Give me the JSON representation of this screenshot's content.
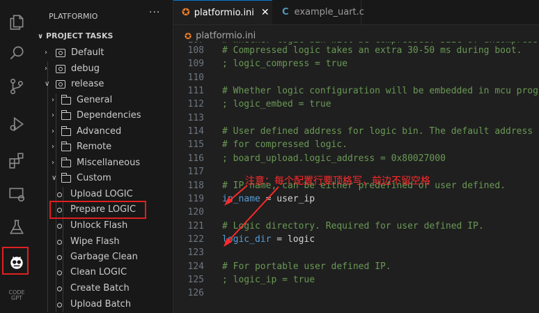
{
  "sidebar": {
    "title": "PLATFORMIO",
    "more": "···",
    "section": "PROJECT TASKS",
    "envs": [
      "Default",
      "debug",
      "release"
    ],
    "folders": [
      "General",
      "Dependencies",
      "Advanced",
      "Remote",
      "Miscellaneous",
      "Custom"
    ],
    "tasks": [
      "Upload LOGIC",
      "Prepare LOGIC",
      "Unlock Flash",
      "Wipe Flash",
      "Garbage Clean",
      "Clean LOGIC",
      "Create Batch",
      "Upload Batch"
    ]
  },
  "tabs": [
    {
      "label": "platformio.ini",
      "close": "✕"
    },
    {
      "label": "example_uart.c"
    }
  ],
  "breadcrumb": "platformio.ini",
  "code": {
    "partial_top": "# Whether logic bin will be compressed. Size of uncompress",
    "lines": [
      {
        "n": "107",
        "text": ""
      },
      {
        "n": "108",
        "text": "# Compressed logic takes an extra 30-50 ms during boot."
      },
      {
        "n": "109",
        "text": "; logic_compress = true"
      },
      {
        "n": "110",
        "text": ""
      },
      {
        "n": "111",
        "text": "# Whether logic configuration will be embedded in mcu prog"
      },
      {
        "n": "112",
        "text": "; logic_embed = true"
      },
      {
        "n": "113",
        "text": ""
      },
      {
        "n": "114",
        "text": "# User defined address for logic bin. The default address"
      },
      {
        "n": "115",
        "text": "# for compressed logic."
      },
      {
        "n": "116",
        "text": "; board_upload.logic_address = 0x80027000"
      },
      {
        "n": "117",
        "text": ""
      },
      {
        "n": "118",
        "text": "# IP name, can be either predefined or user defined."
      },
      {
        "n": "119",
        "key": "ip_name",
        "val": " = user_ip"
      },
      {
        "n": "120",
        "text": ""
      },
      {
        "n": "121",
        "text": "# Logic directory. Required for user defined IP."
      },
      {
        "n": "122",
        "key": "logic_dir",
        "val": " = logic"
      },
      {
        "n": "123",
        "text": ""
      },
      {
        "n": "124",
        "text": "# For portable user defined IP."
      },
      {
        "n": "125",
        "text": "; logic_ip = true"
      },
      {
        "n": "126",
        "text": ""
      }
    ]
  },
  "annotation": "注意：每个配置行要顶格写，前边不留空格",
  "icons": [
    "explorer-icon",
    "search-icon",
    "source-control-icon",
    "run-debug-icon",
    "extensions-icon",
    "remote-explorer-icon",
    "testing-icon",
    "platformio-icon",
    "codegpt-icon"
  ],
  "codegpt_label": [
    "CODE",
    "GPT"
  ],
  "colors": {
    "highlight": "#e02020",
    "accent": "#0078d4",
    "comment": "#6a9955",
    "keyword": "#569cd6"
  }
}
